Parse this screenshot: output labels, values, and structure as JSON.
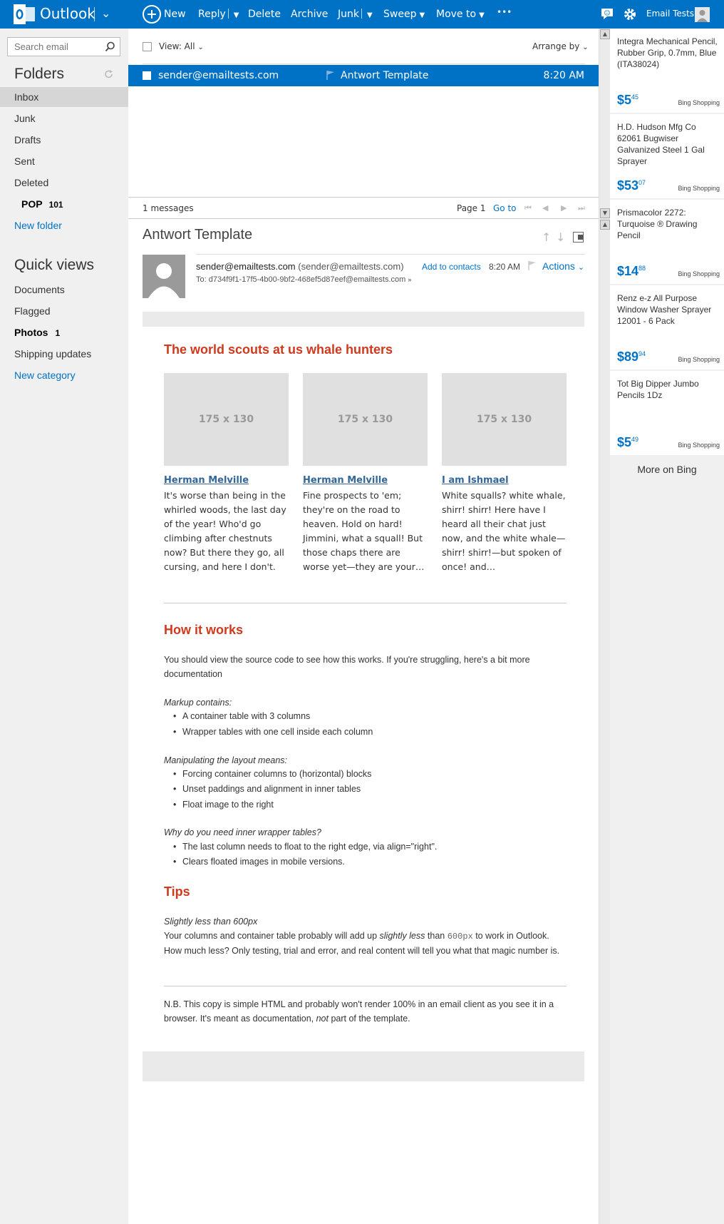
{
  "app": {
    "brand": "Outlook",
    "user_name": "Email Tests"
  },
  "toolbar": {
    "new": "New",
    "reply": "Reply",
    "delete": "Delete",
    "archive": "Archive",
    "junk": "Junk",
    "sweep": "Sweep",
    "move_to": "Move to",
    "more": "•••"
  },
  "search": {
    "placeholder": "Search email"
  },
  "folders": {
    "heading": "Folders",
    "items": [
      {
        "label": "Inbox"
      },
      {
        "label": "Junk"
      },
      {
        "label": "Drafts"
      },
      {
        "label": "Sent"
      },
      {
        "label": "Deleted"
      }
    ],
    "pop": {
      "label": "POP",
      "count": "101"
    },
    "new_folder": "New folder"
  },
  "quick_views": {
    "heading": "Quick views",
    "items": [
      {
        "label": "Documents"
      },
      {
        "label": "Flagged"
      },
      {
        "label": "Photos",
        "count": "1"
      },
      {
        "label": "Shipping updates"
      }
    ],
    "new_category": "New category"
  },
  "list": {
    "view_label": "View: All",
    "arrange_label": "Arrange by",
    "rows": [
      {
        "from": "sender@emailtests.com",
        "subject": "Antwort Template",
        "time": "8:20 AM"
      }
    ],
    "count_text": "1 messages",
    "page_text": "Page 1",
    "goto_text": "Go to"
  },
  "reading": {
    "subject": "Antwort Template",
    "sender_name": "sender@emailtests.com",
    "sender_addr": "(sender@emailtests.com)",
    "add_contacts": "Add to contacts",
    "time": "8:20 AM",
    "actions": "Actions",
    "to_line": "To: d734f9f1-17f5-4b00-9bf2-468ef5d87eef@emailtests.com"
  },
  "email": {
    "heading1": "The world scouts at us whale hunters",
    "columns": [
      {
        "placeholder": "175 x 130",
        "title": "Herman Melville",
        "text": "It's worse than being in the whirled woods, the last day of the year! Who'd go climbing after chestnuts now? But there they go, all cursing, and here I don't."
      },
      {
        "placeholder": "175 x 130",
        "title": "Herman Melville",
        "text": "Fine prospects to 'em; they're on the road to heaven. Hold on hard! Jimmini, what a squall! But those chaps there are worse yet—they are your…"
      },
      {
        "placeholder": "175 x 130",
        "title": "I am Ishmael",
        "text": "White squalls? white whale, shirr! shirr! Here have I heard all their chat just now, and the white whale—shirr! shirr!—but spoken of once! and…"
      }
    ],
    "heading2": "How it works",
    "intro": "You should view the source code to see how this works. If you're struggling, here's a bit more documentation",
    "markup_label": "Markup contains:",
    "markup_items": [
      "A container table with 3 columns",
      "Wrapper tables with one cell inside each column"
    ],
    "manip_label": "Manipulating the layout means:",
    "manip_items": [
      "Forcing container columns to (horizontal) blocks",
      "Unset paddings and alignment in inner tables",
      "Float image to the right"
    ],
    "why_label": "Why do you need inner wrapper tables?",
    "why_items": [
      "The last column needs to float to the right edge, via align=\"right\".",
      "Clears floated images in mobile versions."
    ],
    "heading3": "Tips",
    "tip_label": "Slightly less than 600px",
    "tip_part1": "Your columns and container table probably will add up ",
    "tip_italic": "slightly less",
    "tip_part2": " than ",
    "tip_code": "600px",
    "tip_part3": " to work in Outlook. How much less? Only testing, trial and error, and real content will tell you what that magic number is.",
    "nb_part1": "N.B. This copy is simple HTML and probably won't render 100% in an email client as you see it in a browser. It's meant as documentation, ",
    "nb_italic": "not",
    "nb_part2": " part of the template."
  },
  "ads": [
    {
      "title": "Integra Mechanical Pencil, Rubber Grip, 0.7mm, Blue (ITA38024)",
      "price_main": "$5",
      "price_cents": "45",
      "source": "Bing Shopping"
    },
    {
      "title": "H.D. Hudson Mfg Co 62061 Bugwiser Galvanized Steel 1 Gal Sprayer",
      "price_main": "$53",
      "price_cents": "07",
      "source": "Bing Shopping"
    },
    {
      "title": "Prismacolor 2272: Turquoise ® Drawing Pencil",
      "price_main": "$14",
      "price_cents": "88",
      "source": "Bing Shopping"
    },
    {
      "title": "Renz e-z All Purpose Window Washer Sprayer 12001 - 6 Pack",
      "price_main": "$89",
      "price_cents": "94",
      "source": "Bing Shopping"
    },
    {
      "title": "Tot Big Dipper Jumbo Pencils 1Dz",
      "price_main": "$5",
      "price_cents": "49",
      "source": "Bing Shopping"
    }
  ],
  "more_on_bing": "More on Bing",
  "colors": {
    "accent": "#0072c6",
    "heading_red": "#d0391d",
    "nav_bg": "#f0f0f0"
  },
  "icons": [
    "outlook-logo-icon",
    "plus-circle-icon",
    "search-icon",
    "refresh-icon",
    "flag-icon",
    "gear-icon",
    "feedback-icon",
    "person-icon",
    "popout-icon"
  ]
}
